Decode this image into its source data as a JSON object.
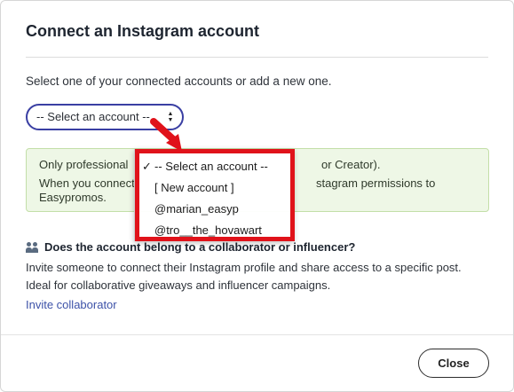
{
  "modal": {
    "title": "Connect an Instagram account",
    "intro": "Select one of your connected accounts or add a new one.",
    "select": {
      "value": "-- Select an account --"
    },
    "note": {
      "line1_start": "Only professional",
      "line1_end": "or Creator).",
      "line2_start": "When you connect",
      "line2_end": "stagram permissions to",
      "line3": "Easypromos."
    },
    "collab": {
      "heading": "Does the account belong to a collaborator or influencer?",
      "line1": "Invite someone to connect their Instagram profile and share access to a specific post.",
      "line2": "Ideal for collaborative giveaways and influencer campaigns.",
      "link": "Invite collaborator"
    },
    "close_label": "Close"
  },
  "dropdown": {
    "check": "✓",
    "options": [
      "-- Select an account --",
      "[ New account ]",
      "@marian_easyp",
      "@tro__the_hovawart"
    ],
    "selected_index": 0
  },
  "colors": {
    "accent": "#3a3fa3",
    "highlight": "#e0121a",
    "note_bg": "#eef7e6",
    "link": "#3d52a8"
  },
  "icons": {
    "collab": "people-icon",
    "select": "updown-chevron-icon",
    "annotation": "red-arrow-icon"
  }
}
